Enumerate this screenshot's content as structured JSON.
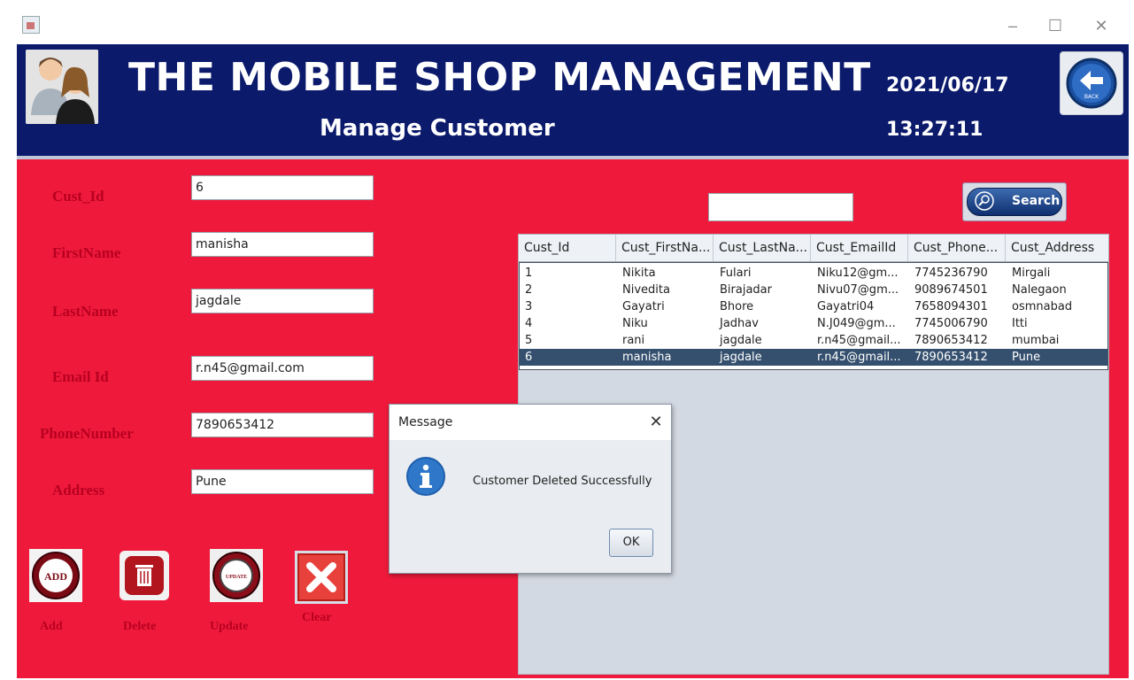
{
  "header": {
    "title": "THE MOBILE SHOP MANAGEMENT",
    "subtitle": "Manage Customer",
    "date": "2021/06/17",
    "time": "13:27:11",
    "back_button_text": "BACK"
  },
  "form": {
    "labels": {
      "cust_id": "Cust_Id",
      "first_name": "FirstName",
      "last_name": "LastName",
      "email": "Email Id",
      "phone": "PhoneNumber",
      "address": "Address"
    },
    "values": {
      "cust_id": "6",
      "first_name": "manisha",
      "last_name": "jagdale",
      "email": "r.n45@gmail.com",
      "phone": "7890653412",
      "address": "Pune"
    }
  },
  "actions": {
    "add_label": "Add",
    "delete_label": "Delete",
    "update_label": "Update",
    "clear_label": "Clear",
    "add_icon_text": "ADD",
    "update_icon_text": "UPDATE"
  },
  "search": {
    "value": "",
    "button_label": "Search"
  },
  "table": {
    "columns": [
      "Cust_Id",
      "Cust_FirstNa...",
      "Cust_LastNa...",
      "Cust_EmailId",
      "Cust_Phone...",
      "Cust_Address"
    ],
    "rows": [
      [
        "1",
        "Nikita",
        "Fulari",
        "Niku12@gm...",
        "7745236790",
        "Mirgali"
      ],
      [
        "2",
        "Nivedita",
        "Birajadar",
        "Nivu07@gm...",
        "9089674501",
        "Nalegaon"
      ],
      [
        "3",
        "Gayatri",
        "Bhore",
        "Gayatri04",
        "7658094301",
        "osmnabad"
      ],
      [
        "4",
        "Niku",
        "Jadhav",
        "N.J049@gm...",
        "7745006790",
        "Itti"
      ],
      [
        "5",
        "rani",
        "jagdale",
        "r.n45@gmail...",
        "7890653412",
        "mumbai"
      ],
      [
        "6",
        "manisha",
        "jagdale",
        "r.n45@gmail...",
        "7890653412",
        "Pune"
      ]
    ],
    "selected_row": 5
  },
  "dialog": {
    "title": "Message",
    "message": "Customer Deleted Successfully",
    "ok_label": "OK"
  },
  "colors": {
    "header_bg": "#0b1a6b",
    "panel_bg": "#ef1a3b",
    "label_color": "#b80020",
    "selected_row": "#35506e"
  },
  "icons": {
    "avatar": "users-icon",
    "back": "arrow-left-icon",
    "search": "magnifier-icon",
    "dialog": "info-icon"
  }
}
